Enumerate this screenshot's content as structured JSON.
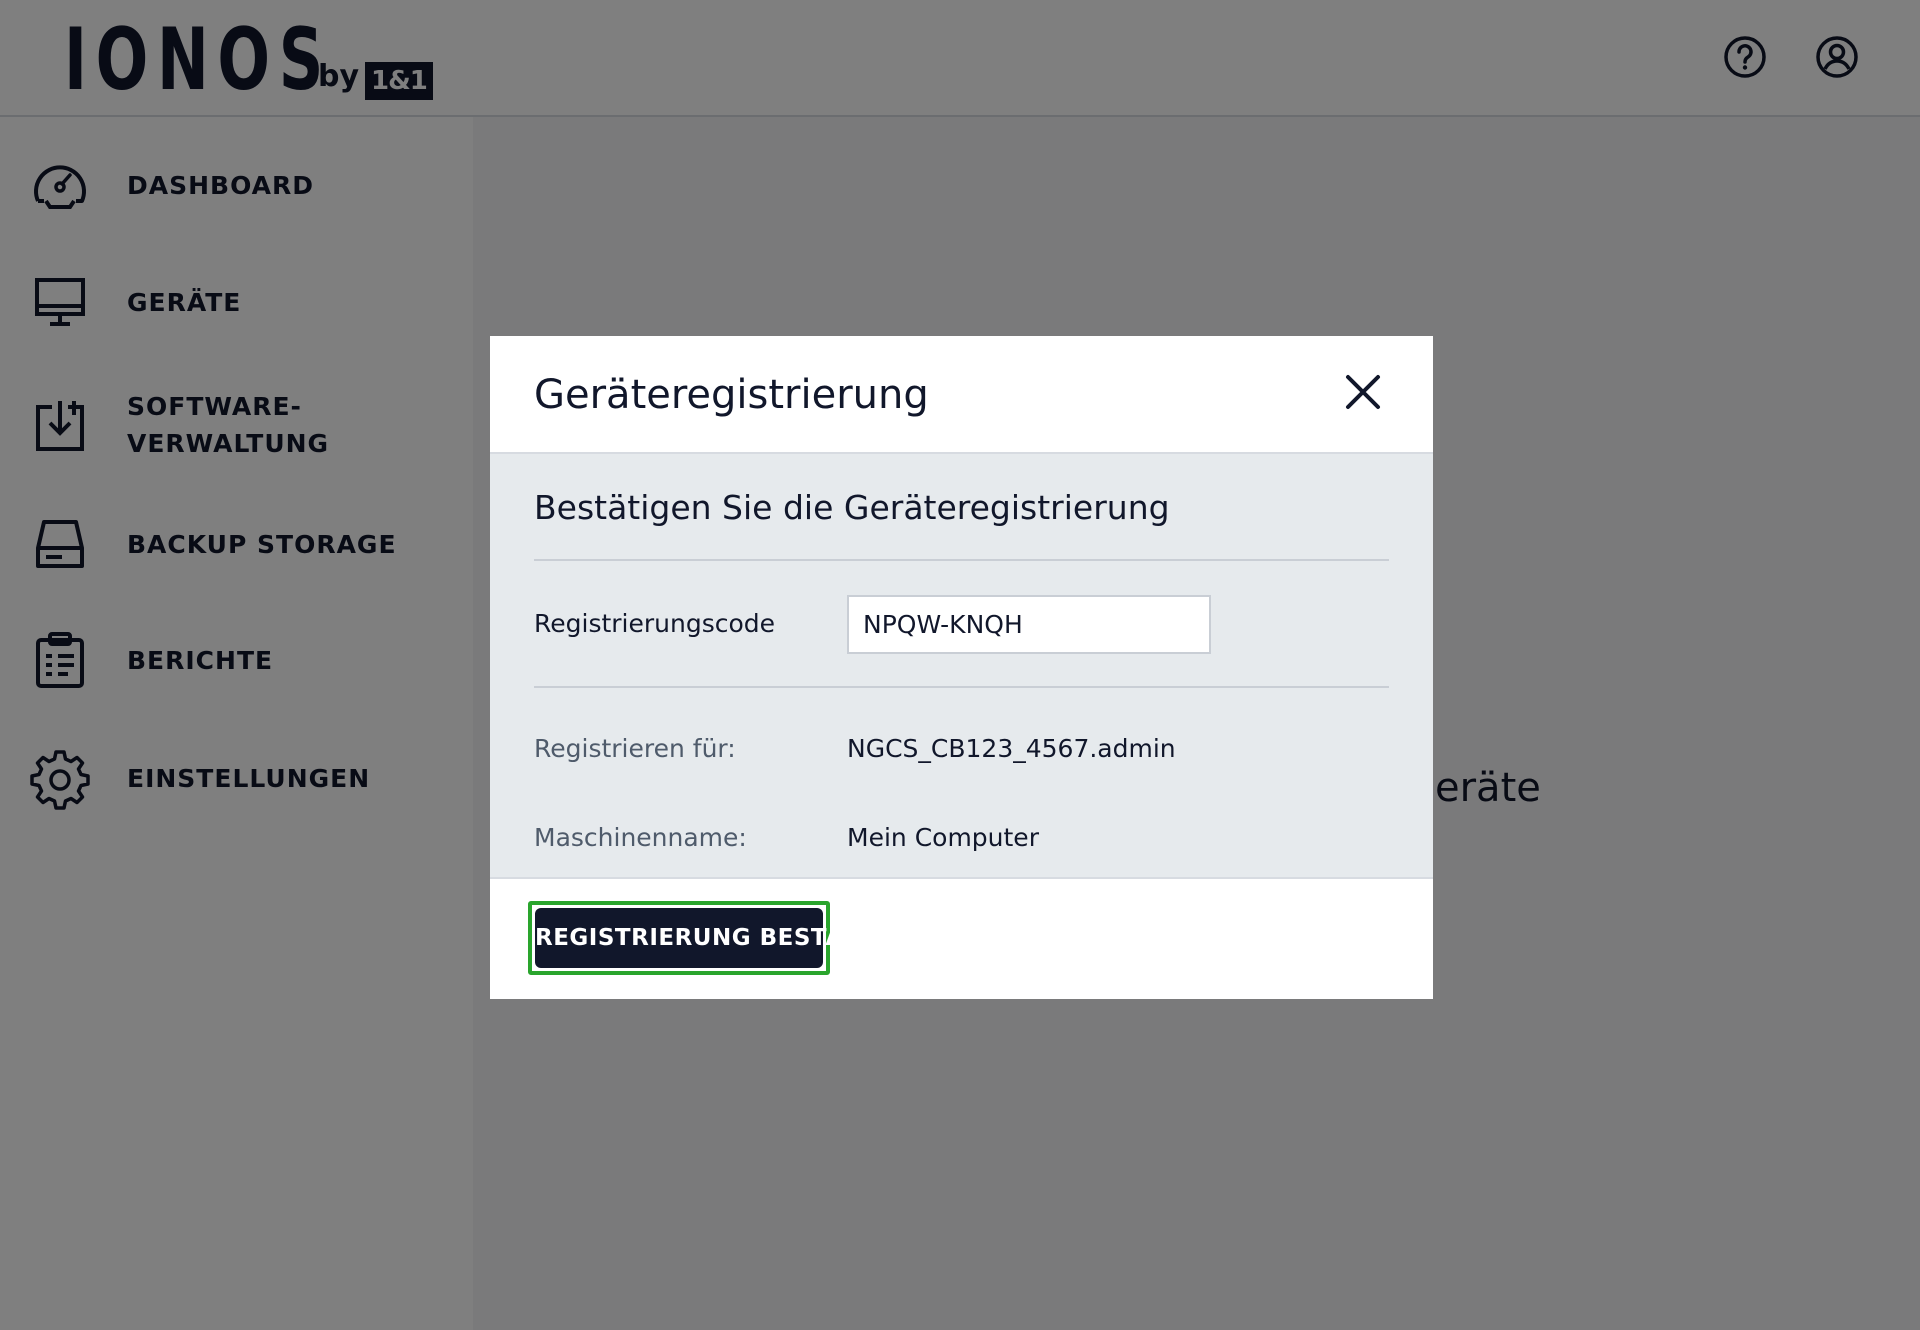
{
  "brand": {
    "logo_word": "IONOS",
    "logo_by": "by",
    "logo_box": "1&1"
  },
  "header": {
    "icons": [
      "help-icon",
      "account-icon"
    ]
  },
  "sidebar": {
    "items": [
      {
        "label": "DASHBOARD",
        "icon": "dashboard-icon"
      },
      {
        "label": "GERÄTE",
        "icon": "monitor-icon"
      },
      {
        "label": "SOFTWARE-\nVERWALTUNG",
        "icon": "software-download-icon"
      },
      {
        "label": "BACKUP STORAGE",
        "icon": "storage-drive-icon"
      },
      {
        "label": "BERICHTE",
        "icon": "report-clipboard-icon"
      },
      {
        "label": "EINSTELLUNGEN",
        "icon": "gear-icon"
      }
    ]
  },
  "background": {
    "partial_text": "Geräte"
  },
  "modal": {
    "title": "Geräteregistrierung",
    "section_title": "Bestätigen Sie die Geräteregistrierung",
    "code_label": "Registrierungscode",
    "code_value": "NPQW-KNQH",
    "register_for_label": "Registrieren für:",
    "register_for_value": "NGCS_CB123_4567.admin",
    "machine_label": "Maschinenname:",
    "machine_value": "Mein Computer",
    "confirm_label": "REGISTRIERUNG BESTÄTIGEN",
    "colors": {
      "primary": "#11172b",
      "highlight": "#2aa52d",
      "body_bg": "#e6eaed"
    }
  }
}
